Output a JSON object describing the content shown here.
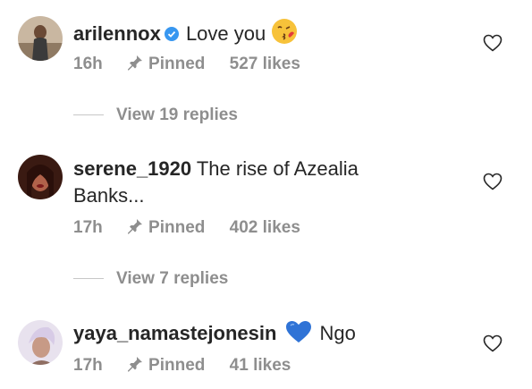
{
  "comments": [
    {
      "username": "arilennox",
      "verified": true,
      "text": "Love you",
      "emoji": "kissing-face-emoji",
      "time": "16h",
      "pinned_label": "Pinned",
      "likes": "527 likes",
      "view_replies": "View 19 replies"
    },
    {
      "username": "serene_1920",
      "verified": false,
      "text": "The rise of Azealia",
      "text_line2": "Banks...",
      "time": "17h",
      "pinned_label": "Pinned",
      "likes": "402 likes",
      "view_replies": "View 7 replies"
    },
    {
      "username": "yaya_namastejonesin",
      "verified": false,
      "emoji": "blue-heart-emoji",
      "text": "Ngo",
      "time": "17h",
      "pinned_label": "Pinned",
      "likes": "41 likes"
    }
  ],
  "colors": {
    "text": "#262626",
    "muted": "#8e8e8e",
    "verified": "#3897f0",
    "blue_heart": "#2f73d6"
  }
}
